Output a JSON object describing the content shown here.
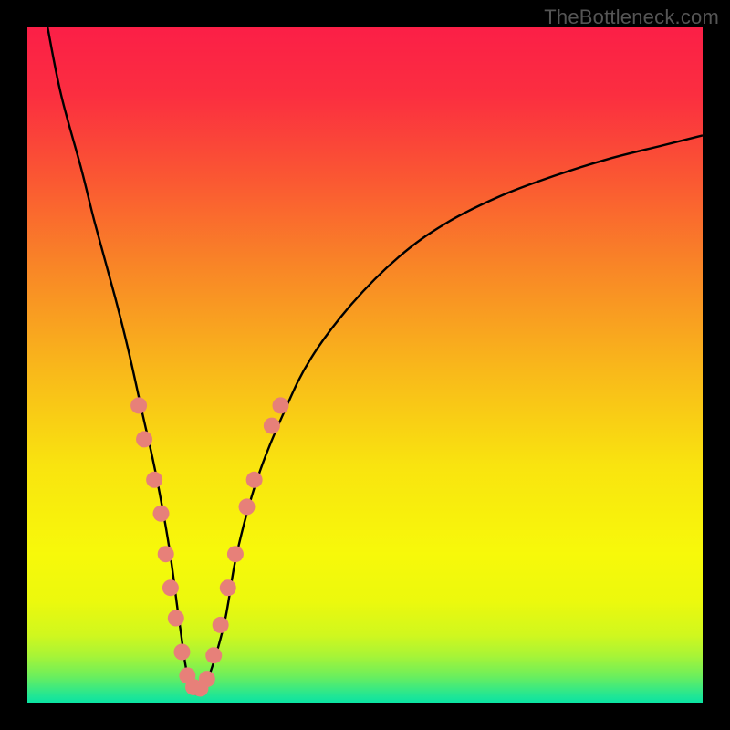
{
  "watermark": "TheBottleneck.com",
  "gradient": {
    "stops": [
      {
        "offset": 0,
        "color": "#fb1f47"
      },
      {
        "offset": 0.1,
        "color": "#fb2e40"
      },
      {
        "offset": 0.22,
        "color": "#fa5633"
      },
      {
        "offset": 0.35,
        "color": "#f98427"
      },
      {
        "offset": 0.5,
        "color": "#f9b61b"
      },
      {
        "offset": 0.65,
        "color": "#f9e40f"
      },
      {
        "offset": 0.78,
        "color": "#f7f90a"
      },
      {
        "offset": 0.85,
        "color": "#ecf90d"
      },
      {
        "offset": 0.9,
        "color": "#d0f71e"
      },
      {
        "offset": 0.93,
        "color": "#a9f436"
      },
      {
        "offset": 0.96,
        "color": "#6eef5b"
      },
      {
        "offset": 0.99,
        "color": "#20e695"
      },
      {
        "offset": 1.0,
        "color": "#0be3a3"
      }
    ]
  },
  "chart_data": {
    "type": "line",
    "title": "",
    "xlabel": "",
    "ylabel": "",
    "x_range": [
      0,
      100
    ],
    "y_range": [
      0,
      100
    ],
    "series": [
      {
        "name": "bottleneck-curve",
        "x": [
          3,
          5,
          8,
          10,
          13,
          15,
          17,
          19,
          21,
          22.5,
          24,
          26,
          29,
          31,
          34,
          38,
          42,
          48,
          55,
          62,
          70,
          78,
          86,
          94,
          100
        ],
        "values": [
          100,
          90,
          79,
          71,
          60,
          52,
          43,
          34,
          23,
          12,
          3,
          2,
          11,
          22,
          33,
          43,
          51,
          59,
          66,
          71,
          75,
          78,
          80.5,
          82.5,
          84
        ]
      }
    ],
    "highlight_points": {
      "name": "highlighted-dots",
      "color": "#e78079",
      "radius": 9,
      "points": [
        {
          "x": 16.5,
          "y": 44
        },
        {
          "x": 17.3,
          "y": 39
        },
        {
          "x": 18.8,
          "y": 33
        },
        {
          "x": 19.8,
          "y": 28
        },
        {
          "x": 20.5,
          "y": 22
        },
        {
          "x": 21.2,
          "y": 17
        },
        {
          "x": 22.0,
          "y": 12.5
        },
        {
          "x": 22.9,
          "y": 7.5
        },
        {
          "x": 23.7,
          "y": 4
        },
        {
          "x": 24.6,
          "y": 2.3
        },
        {
          "x": 25.6,
          "y": 2.1
        },
        {
          "x": 26.6,
          "y": 3.5
        },
        {
          "x": 27.6,
          "y": 7
        },
        {
          "x": 28.6,
          "y": 11.5
        },
        {
          "x": 29.7,
          "y": 17
        },
        {
          "x": 30.8,
          "y": 22
        },
        {
          "x": 32.5,
          "y": 29
        },
        {
          "x": 33.6,
          "y": 33
        },
        {
          "x": 36.2,
          "y": 41
        },
        {
          "x": 37.5,
          "y": 44
        }
      ]
    }
  }
}
